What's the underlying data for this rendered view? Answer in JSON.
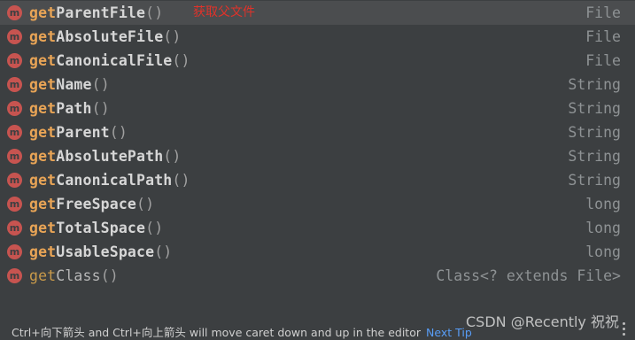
{
  "popup": {
    "items": [
      {
        "prefix": "get",
        "rest": "ParentFile",
        "parens": "()",
        "type": "File",
        "annotation": "获取父文件",
        "selected": true
      },
      {
        "prefix": "get",
        "rest": "AbsoluteFile",
        "parens": "()",
        "type": "File"
      },
      {
        "prefix": "get",
        "rest": "CanonicalFile",
        "parens": "()",
        "type": "File"
      },
      {
        "prefix": "get",
        "rest": "Name",
        "parens": "()",
        "type": "String"
      },
      {
        "prefix": "get",
        "rest": "Path",
        "parens": "()",
        "type": "String"
      },
      {
        "prefix": "get",
        "rest": "Parent",
        "parens": "()",
        "type": "String"
      },
      {
        "prefix": "get",
        "rest": "AbsolutePath",
        "parens": "()",
        "type": "String"
      },
      {
        "prefix": "get",
        "rest": "CanonicalPath",
        "parens": "()",
        "type": "String"
      },
      {
        "prefix": "get",
        "rest": "FreeSpace",
        "parens": "()",
        "type": "long"
      },
      {
        "prefix": "get",
        "rest": "TotalSpace",
        "parens": "()",
        "type": "long"
      },
      {
        "prefix": "get",
        "rest": "UsableSpace",
        "parens": "()",
        "type": "long"
      },
      {
        "prefix": "get",
        "rest": "Class",
        "parens": "()",
        "type": "Class<? extends File>",
        "plain": true
      }
    ],
    "method_icon_letter": "m"
  },
  "footer": {
    "hint": "Ctrl+向下箭头 and Ctrl+向上箭头 will move caret down and up in the editor",
    "next_tip": "Next Tip"
  },
  "watermark": "CSDN @Recently 祝祝",
  "colors": {
    "method_icon": "#c75450",
    "match_prefix": "#e8a456",
    "annotation": "#e0322a",
    "link": "#589df6"
  }
}
